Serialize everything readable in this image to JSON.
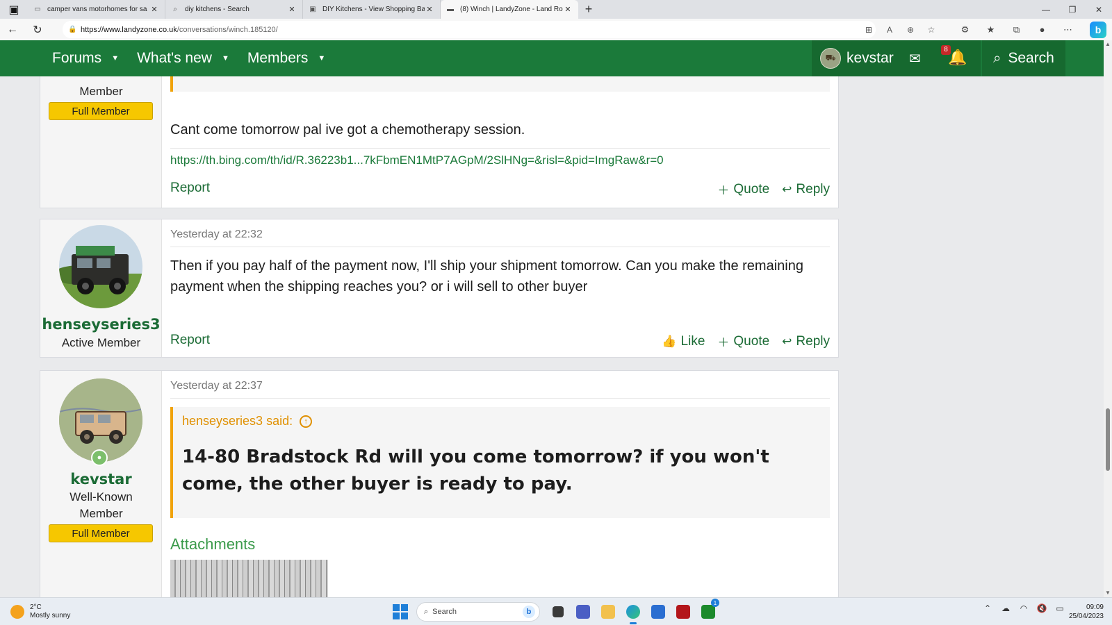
{
  "browser": {
    "tabs": [
      {
        "title": "camper vans motorhomes for sa",
        "icon": "page-icon",
        "active": false
      },
      {
        "title": "diy kitchens - Search",
        "icon": "search-icon",
        "active": false
      },
      {
        "title": "DIY Kitchens - View Shopping Ba",
        "icon": "page-icon",
        "active": false
      },
      {
        "title": "(8) Winch | LandyZone - Land Ro",
        "icon": "landrover-icon",
        "active": true
      }
    ],
    "new_tab": "+",
    "url_domain": "https://www.landyzone.co.uk",
    "url_path": "/conversations/winch.185120/"
  },
  "site": {
    "nav": [
      {
        "label": "Forums"
      },
      {
        "label": "What's new"
      },
      {
        "label": "Members"
      }
    ],
    "user": "kevstar",
    "alert_count": "8",
    "search_label": "Search"
  },
  "posts": [
    {
      "role": "Member",
      "badge": "Full Member",
      "message": "Cant come tomorrow pal ive got a chemotherapy session.",
      "link": "https://th.bing.com/th/id/R.36223b1...7kFbmEN1MtP7AGpM/2SlHNg=&risl=&pid=ImgRaw&r=0",
      "report": "Report",
      "quote": "Quote",
      "reply": "Reply"
    },
    {
      "username": "henseyseries3",
      "role": "Active Member",
      "timestamp": "Yesterday at 22:32",
      "message": "Then if you pay half of the payment now, I'll ship your shipment tomorrow. Can you make the remaining payment when the shipping reaches you? or i will sell to other buyer",
      "report": "Report",
      "like": "Like",
      "quote": "Quote",
      "reply": "Reply"
    },
    {
      "username": "kevstar",
      "role_line1": "Well-Known",
      "role_line2": "Member",
      "badge": "Full Member",
      "timestamp": "Yesterday at 22:37",
      "quote_author": "henseyseries3 said:",
      "quote_text": "14-80 Bradstock Rd will you come tomorrow? if you won't come, the other buyer is ready to pay.",
      "attachments_title": "Attachments"
    }
  ],
  "taskbar": {
    "temperature": "2°C",
    "weather": "Mostly sunny",
    "search_placeholder": "Search",
    "time": "09:09",
    "date": "25/04/2023",
    "xbox_badge": "1"
  },
  "colors": {
    "brand_green": "#1b7a3a",
    "badge_yellow": "#f6c700",
    "quote_orange": "#f0a30a"
  }
}
